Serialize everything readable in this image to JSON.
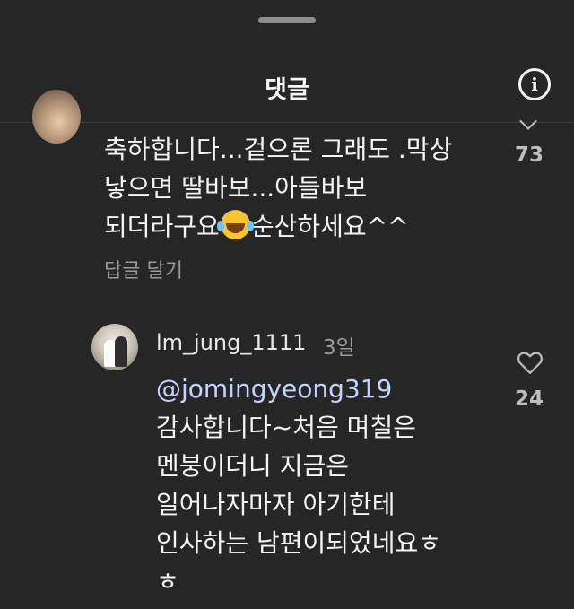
{
  "header": {
    "title": "댓글",
    "info_icon": "info-icon"
  },
  "comments": [
    {
      "lines": [
        "축하합니다...겉으론 그래도 .막상",
        "낳으면 딸바보...아들바보"
      ],
      "line3_before": "되더라구요",
      "emoji": "face-with-tears-of-joy",
      "line3_after": "순산하세요^^",
      "reply_label": "답글 달기",
      "like_count": "73"
    }
  ],
  "reply": {
    "username": "lm_jung_1111",
    "time": "3일",
    "mention": "@jomingyeong319",
    "lines": [
      "감사합니다~처음 며칠은",
      "멘붕이더니 지금은",
      "일어나자마자 아기한테",
      "인사하는 남편이되었네요ㅎ",
      "ㅎ"
    ],
    "like_count": "24"
  }
}
